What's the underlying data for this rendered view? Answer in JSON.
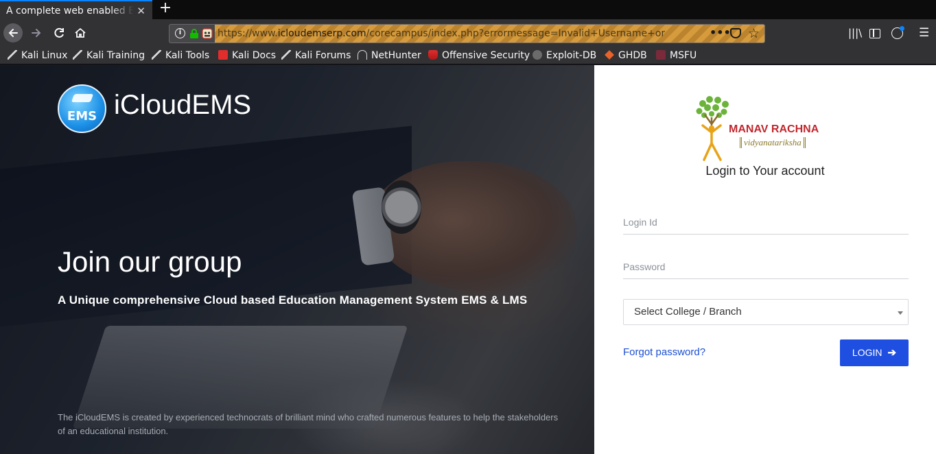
{
  "browser": {
    "tab_title": "A complete web enabled Education",
    "tab_close": "✕",
    "new_tab": "+",
    "url_prefix": "https://www.",
    "url_domain": "icloudemserp.com",
    "url_rest": "/corecampus/index.php?errormessage=Invalid+Username+or+Passwo",
    "more_actions": "•••",
    "bookmarks": [
      {
        "label": "Kali Linux",
        "icon": "kali-dragon-icon"
      },
      {
        "label": "Kali Training",
        "icon": "kali-dragon-icon"
      },
      {
        "label": "Kali Tools",
        "icon": "kali-dragon-icon"
      },
      {
        "label": "Kali Docs",
        "icon": "kali-docs-icon"
      },
      {
        "label": "Kali Forums",
        "icon": "kali-dragon-icon"
      },
      {
        "label": "NetHunter",
        "icon": "nethunter-icon"
      },
      {
        "label": "Offensive Security",
        "icon": "offsec-icon"
      },
      {
        "label": "Exploit-DB",
        "icon": "exploit-db-icon"
      },
      {
        "label": "GHDB",
        "icon": "ghdb-icon"
      },
      {
        "label": "MSFU",
        "icon": "msfu-icon"
      }
    ]
  },
  "hero": {
    "logo_text": "EMS",
    "brand": "iCloudEMS",
    "title": "Join our group",
    "subtitle": "A Unique comprehensive Cloud based Education Management System EMS & LMS",
    "footer": "The iCloudEMS is created by experienced technocrats of brilliant mind who crafted numerous features to help the stakeholders of an educational institution."
  },
  "login": {
    "org_name": "MANAV RACHNA",
    "org_tagline": "vidyanatariksha",
    "heading": "Login to Your account",
    "login_id_placeholder": "Login Id",
    "password_placeholder": "Password",
    "select_value": "Select College / Branch",
    "forgot_label": "Forgot password?",
    "login_label": "LOGIN",
    "login_icon": "➔"
  },
  "colors": {
    "accent": "#1f4fe0",
    "link": "#1c4fd1",
    "brand_red": "#c1272d",
    "url_warning": "#e6a43a"
  }
}
